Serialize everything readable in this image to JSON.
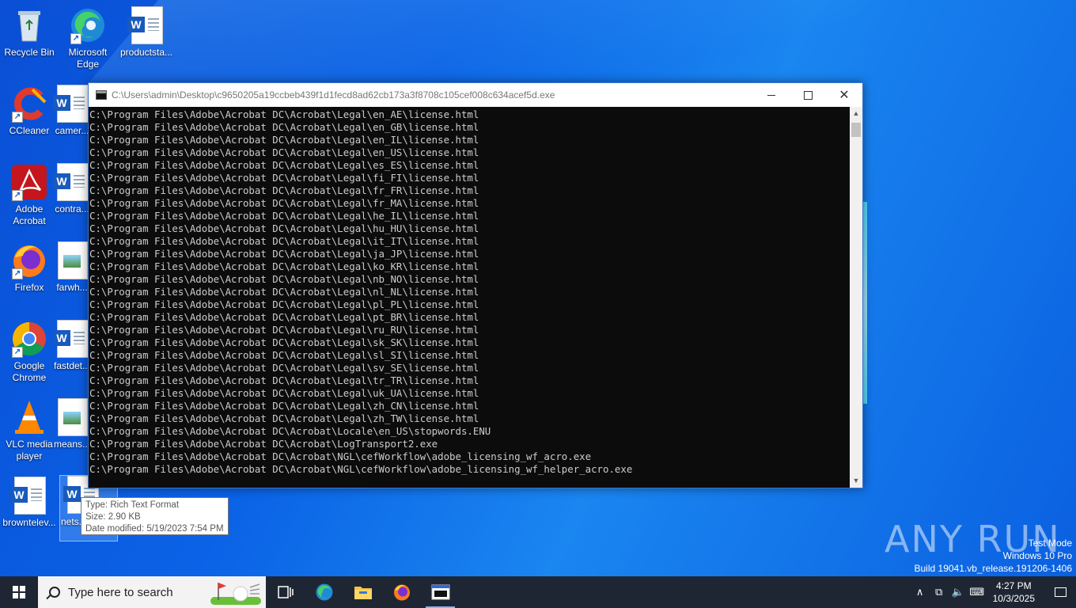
{
  "desktop": {
    "icons": [
      {
        "label": "Recycle Bin"
      },
      {
        "label": "Microsoft Edge"
      },
      {
        "label": "productsta..."
      },
      {
        "label": "CCleaner"
      },
      {
        "label": "camer..."
      },
      {
        "label": "Adobe Acrobat"
      },
      {
        "label": "contra..."
      },
      {
        "label": "Firefox"
      },
      {
        "label": "farwh..."
      },
      {
        "label": "Google Chrome"
      },
      {
        "label": "fastdet..."
      },
      {
        "label": "VLC media player"
      },
      {
        "label": "means..."
      },
      {
        "label": "browntelev..."
      },
      {
        "label": "nets..."
      }
    ]
  },
  "window": {
    "title": "C:\\Users\\admin\\Desktop\\c9650205a19ccbeb439f1d1fecd8ad62cb173a3f8708c105cef008c634acef5d.exe",
    "lines": [
      "C:\\Program Files\\Adobe\\Acrobat DC\\Acrobat\\Legal\\en_AE\\license.html",
      "C:\\Program Files\\Adobe\\Acrobat DC\\Acrobat\\Legal\\en_GB\\license.html",
      "C:\\Program Files\\Adobe\\Acrobat DC\\Acrobat\\Legal\\en_IL\\license.html",
      "C:\\Program Files\\Adobe\\Acrobat DC\\Acrobat\\Legal\\en_US\\license.html",
      "C:\\Program Files\\Adobe\\Acrobat DC\\Acrobat\\Legal\\es_ES\\license.html",
      "C:\\Program Files\\Adobe\\Acrobat DC\\Acrobat\\Legal\\fi_FI\\license.html",
      "C:\\Program Files\\Adobe\\Acrobat DC\\Acrobat\\Legal\\fr_FR\\license.html",
      "C:\\Program Files\\Adobe\\Acrobat DC\\Acrobat\\Legal\\fr_MA\\license.html",
      "C:\\Program Files\\Adobe\\Acrobat DC\\Acrobat\\Legal\\he_IL\\license.html",
      "C:\\Program Files\\Adobe\\Acrobat DC\\Acrobat\\Legal\\hu_HU\\license.html",
      "C:\\Program Files\\Adobe\\Acrobat DC\\Acrobat\\Legal\\it_IT\\license.html",
      "C:\\Program Files\\Adobe\\Acrobat DC\\Acrobat\\Legal\\ja_JP\\license.html",
      "C:\\Program Files\\Adobe\\Acrobat DC\\Acrobat\\Legal\\ko_KR\\license.html",
      "C:\\Program Files\\Adobe\\Acrobat DC\\Acrobat\\Legal\\nb_NO\\license.html",
      "C:\\Program Files\\Adobe\\Acrobat DC\\Acrobat\\Legal\\nl_NL\\license.html",
      "C:\\Program Files\\Adobe\\Acrobat DC\\Acrobat\\Legal\\pl_PL\\license.html",
      "C:\\Program Files\\Adobe\\Acrobat DC\\Acrobat\\Legal\\pt_BR\\license.html",
      "C:\\Program Files\\Adobe\\Acrobat DC\\Acrobat\\Legal\\ru_RU\\license.html",
      "C:\\Program Files\\Adobe\\Acrobat DC\\Acrobat\\Legal\\sk_SK\\license.html",
      "C:\\Program Files\\Adobe\\Acrobat DC\\Acrobat\\Legal\\sl_SI\\license.html",
      "C:\\Program Files\\Adobe\\Acrobat DC\\Acrobat\\Legal\\sv_SE\\license.html",
      "C:\\Program Files\\Adobe\\Acrobat DC\\Acrobat\\Legal\\tr_TR\\license.html",
      "C:\\Program Files\\Adobe\\Acrobat DC\\Acrobat\\Legal\\uk_UA\\license.html",
      "C:\\Program Files\\Adobe\\Acrobat DC\\Acrobat\\Legal\\zh_CN\\license.html",
      "C:\\Program Files\\Adobe\\Acrobat DC\\Acrobat\\Legal\\zh_TW\\license.html",
      "C:\\Program Files\\Adobe\\Acrobat DC\\Acrobat\\Locale\\en_US\\stopwords.ENU",
      "C:\\Program Files\\Adobe\\Acrobat DC\\Acrobat\\LogTransport2.exe",
      "C:\\Program Files\\Adobe\\Acrobat DC\\Acrobat\\NGL\\cefWorkflow\\adobe_licensing_wf_acro.exe",
      "C:\\Program Files\\Adobe\\Acrobat DC\\Acrobat\\NGL\\cefWorkflow\\adobe_licensing_wf_helper_acro.exe"
    ]
  },
  "tooltip": {
    "type": "Type: Rich Text Format",
    "size": "Size: 2.90 KB",
    "modified": "Date modified: 5/19/2023 7:54 PM"
  },
  "watermark": {
    "brand": "ANY RUN",
    "line1": "Test Mode",
    "line2": "Windows 10 Pro",
    "line3": "Build 19041.vb_release.191206-1406"
  },
  "taskbar": {
    "search_placeholder": "Type here to search",
    "time": "4:27 PM",
    "date": "10/3/2025"
  },
  "colors": {
    "desktop_bg": "#0b63e6",
    "taskbar_bg": "#1f2633",
    "console_bg": "#0c0c0c",
    "console_fg": "#cccccc"
  }
}
